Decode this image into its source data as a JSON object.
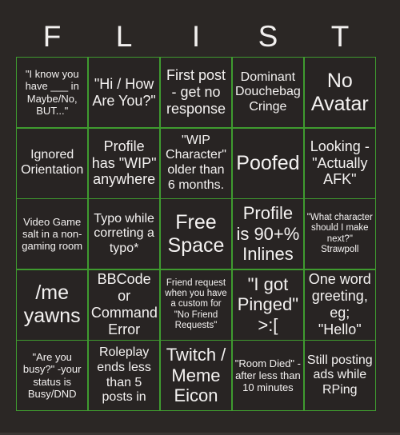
{
  "header": {
    "letters": [
      "F",
      "L",
      "I",
      "S",
      "T"
    ]
  },
  "grid": {
    "columns": 5,
    "rows": 5,
    "line_color": "#3f9b2f",
    "cell_background": "#282423",
    "text_color": "#f4f2f1",
    "page_background": "#2b2725",
    "cells": [
      {
        "text": "\"I know you have ___ in Maybe/No, BUT...\"",
        "size": "fs-s"
      },
      {
        "text": "\"Hi / How Are You?\"",
        "size": "fs-l"
      },
      {
        "text": "First post - get no response",
        "size": "fs-l"
      },
      {
        "text": "Dominant Douchebag Cringe",
        "size": "fs-m"
      },
      {
        "text": "No Avatar",
        "size": "fs-xxl"
      },
      {
        "text": "Ignored Orientation",
        "size": "fs-m"
      },
      {
        "text": "Profile has \"WIP\" anywhere",
        "size": "fs-l"
      },
      {
        "text": "\"WIP Character\" older than 6 months.",
        "size": "fs-m"
      },
      {
        "text": "Poofed",
        "size": "fs-xxl"
      },
      {
        "text": "Looking - \"Actually AFK\"",
        "size": "fs-l"
      },
      {
        "text": "Video Game salt in a non-gaming room",
        "size": "fs-s"
      },
      {
        "text": "Typo while correting a typo*",
        "size": "fs-m"
      },
      {
        "text": "Free Space",
        "size": "fs-xxl"
      },
      {
        "text": "Profile is 90+% Inlines",
        "size": "fs-xl"
      },
      {
        "text": "\"What character should I make next?\" Strawpoll",
        "size": "fs-xs"
      },
      {
        "text": "/me yawns",
        "size": "fs-xxl"
      },
      {
        "text": "BBCode or Command Error",
        "size": "fs-l"
      },
      {
        "text": "Friend request when you have a custom for \"No Friend Requests\"",
        "size": "fs-xs"
      },
      {
        "text": "\"I got Pinged\" >:[",
        "size": "fs-xl"
      },
      {
        "text": "One word greeting, eg; \"Hello\"",
        "size": "fs-l"
      },
      {
        "text": "\"Are you busy?\" -your status is Busy/DND",
        "size": "fs-s"
      },
      {
        "text": "Roleplay ends less than 5 posts in",
        "size": "fs-m"
      },
      {
        "text": "Twitch / Meme Eicon",
        "size": "fs-xl"
      },
      {
        "text": "\"Room Died\" - after less than 10 minutes",
        "size": "fs-s"
      },
      {
        "text": "Still posting ads while RPing",
        "size": "fs-m"
      }
    ]
  }
}
